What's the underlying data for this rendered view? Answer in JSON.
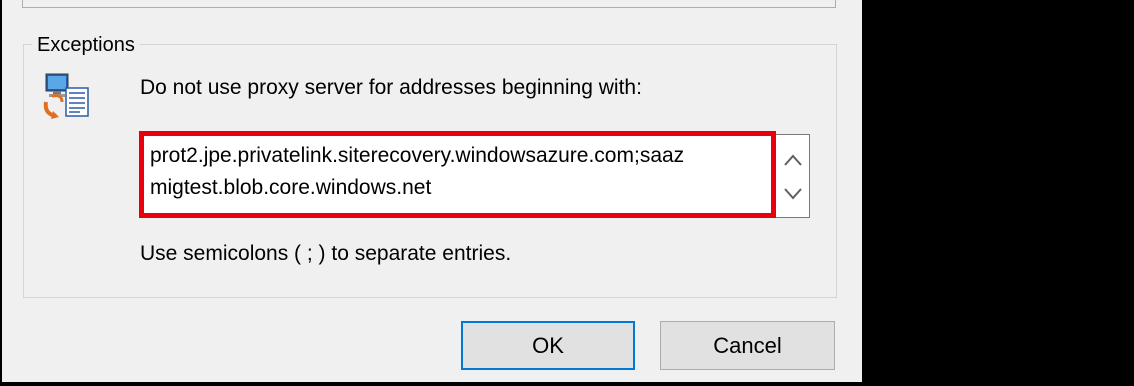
{
  "exceptions": {
    "title": "Exceptions",
    "description": "Do not use proxy server for addresses beginning with:",
    "addresses_line1": "prot2.jpe.privatelink.siterecovery.windowsazure.com;saaz",
    "addresses_line2": "migtest.blob.core.windows.net",
    "hint": "Use semicolons ( ; ) to separate entries."
  },
  "buttons": {
    "ok": "OK",
    "cancel": "Cancel"
  },
  "colors": {
    "highlight": "#e8000d",
    "focus_border": "#0078d7",
    "dialog_bg": "#f0f0f0",
    "outside_bg": "#000000"
  },
  "icons": {
    "proxy": "network-computer-icon",
    "scroll_up": "chevron-up-icon",
    "scroll_down": "chevron-down-icon"
  }
}
